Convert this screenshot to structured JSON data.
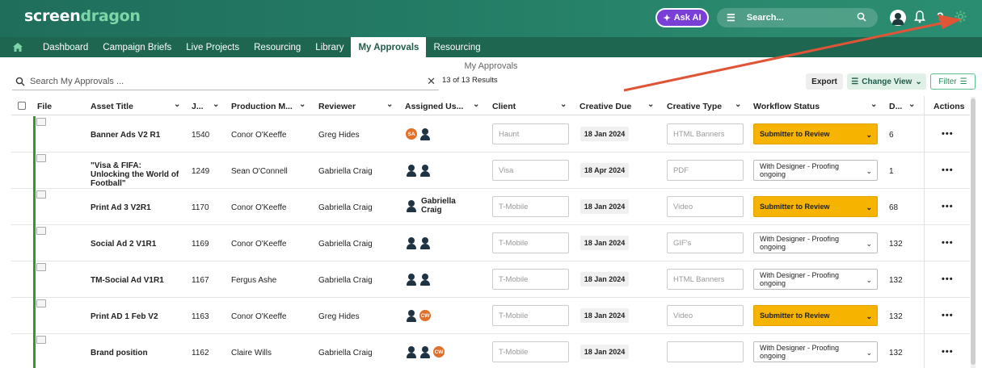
{
  "app": {
    "logo_part1": "screen",
    "logo_part2": "dragon",
    "ask_ai": "Ask AI",
    "search_placeholder": "Search...",
    "gear_color": "#5bbf8a"
  },
  "nav": {
    "items": [
      {
        "label": "Dashboard"
      },
      {
        "label": "Campaign Briefs"
      },
      {
        "label": "Live Projects"
      },
      {
        "label": "Resourcing"
      },
      {
        "label": "Library"
      },
      {
        "label": "My Approvals",
        "active": true
      },
      {
        "label": "Resourcing"
      }
    ]
  },
  "page": {
    "title": "My Approvals",
    "search_placeholder": "Search  My Approvals ...",
    "results": "13 of 13 Results",
    "export": "Export",
    "change_view": "Change View",
    "filter": "Filter"
  },
  "columns": {
    "file": "File",
    "asset_title": "Asset Title",
    "job": "J...",
    "production_manager": "Production M...",
    "reviewer": "Reviewer",
    "assigned_users": "Assigned Us...",
    "client": "Client",
    "creative_due": "Creative Due",
    "creative_type": "Creative Type",
    "workflow_status": "Workflow Status",
    "days": "D...",
    "actions": "Actions"
  },
  "rows": [
    {
      "asset": "Banner Ads V2 R1",
      "job": "1540",
      "prod": "Conor O'Keeffe",
      "reviewer": "Greg Hides",
      "assigned": [
        {
          "type": "init",
          "text": "SA"
        },
        {
          "type": "person"
        }
      ],
      "client": "Haunt",
      "due": "18 Jan 2024",
      "ctype": "HTML Banners",
      "wf": "Submitter to Review",
      "wf_style": "yellow",
      "days": "6"
    },
    {
      "asset": "\"Visa & FIFA: Unlocking the World of Football\"",
      "job": "1249",
      "prod": "Sean O'Connell",
      "reviewer": "Gabriella Craig",
      "assigned": [
        {
          "type": "person"
        },
        {
          "type": "person"
        }
      ],
      "client": "Visa",
      "due": "18 Apr 2024",
      "ctype": "PDF",
      "wf": "With Designer - Proofing ongoing",
      "wf_style": "white",
      "days": "1"
    },
    {
      "asset": "Print Ad 3 V2R1",
      "job": "1170",
      "prod": "Conor O'Keeffe",
      "reviewer": "Gabriella Craig",
      "assigned": [
        {
          "type": "person"
        }
      ],
      "assigned_name": "Gabriella Craig",
      "client": "T-Mobile",
      "due": "18 Jan 2024",
      "ctype": "Video",
      "wf": "Submitter to Review",
      "wf_style": "yellow",
      "days": "68"
    },
    {
      "asset": "Social Ad 2 V1R1",
      "job": "1169",
      "prod": "Conor O'Keeffe",
      "reviewer": "Gabriella Craig",
      "assigned": [
        {
          "type": "person"
        },
        {
          "type": "person"
        }
      ],
      "client": "T-Mobile",
      "due": "18 Jan 2024",
      "ctype": "GIF's",
      "wf": "With Designer - Proofing ongoing",
      "wf_style": "white",
      "days": "132"
    },
    {
      "asset": "TM-Social Ad V1R1",
      "job": "1167",
      "prod": "Fergus Ashe",
      "reviewer": "Gabriella Craig",
      "assigned": [
        {
          "type": "person"
        },
        {
          "type": "person"
        }
      ],
      "client": "T-Mobile",
      "due": "18 Jan 2024",
      "ctype": "HTML Banners",
      "wf": "With Designer - Proofing ongoing",
      "wf_style": "white",
      "days": "132"
    },
    {
      "asset": "Print AD 1 Feb V2",
      "job": "1163",
      "prod": "Conor O'Keeffe",
      "reviewer": "Greg Hides",
      "assigned": [
        {
          "type": "person"
        },
        {
          "type": "init",
          "text": "CW"
        }
      ],
      "client": "T-Mobile",
      "due": "18 Jan 2024",
      "ctype": "Video",
      "wf": "Submitter to Review",
      "wf_style": "yellow",
      "days": "132"
    },
    {
      "asset": "Brand position",
      "job": "1162",
      "prod": "Claire Wills",
      "reviewer": "Gabriella Craig",
      "assigned": [
        {
          "type": "person"
        },
        {
          "type": "person"
        },
        {
          "type": "init",
          "text": "CW"
        }
      ],
      "client": "T-Mobile",
      "due": "18 Jan 2024",
      "ctype": "",
      "wf": "With Designer - Proofing ongoing",
      "wf_style": "white",
      "days": "132"
    }
  ],
  "row_action": "•••"
}
